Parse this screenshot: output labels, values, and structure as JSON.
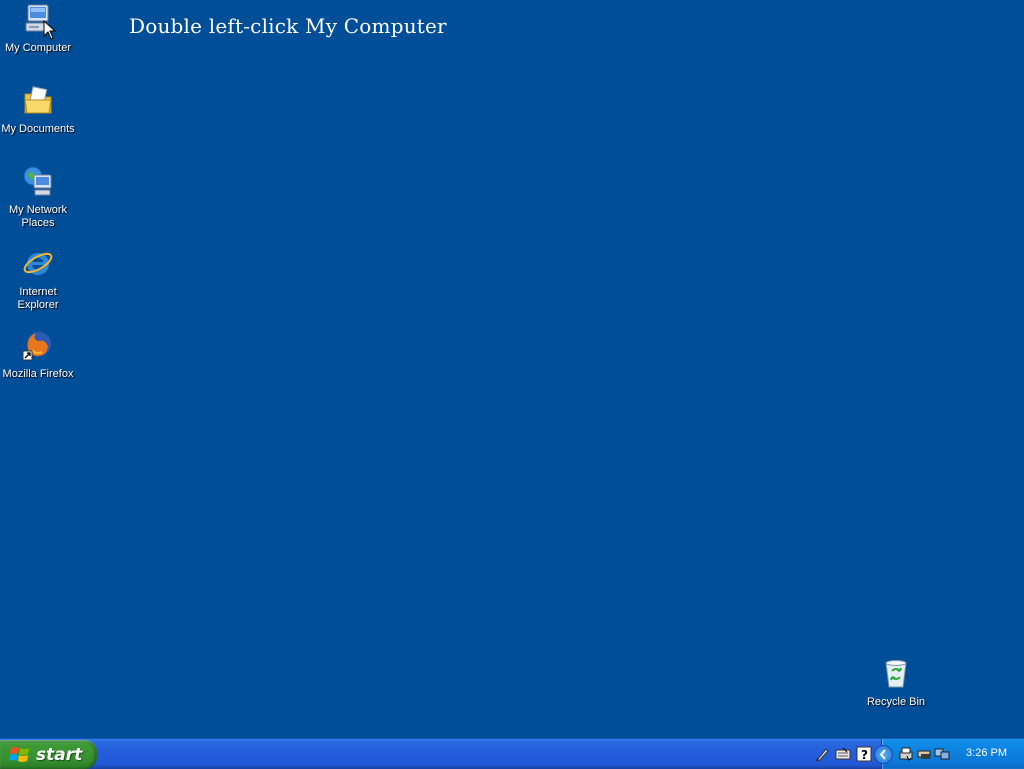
{
  "desktop": {
    "instruction": "Double left-click My Computer",
    "icons": [
      {
        "label": "My Computer",
        "icon": "my-computer-icon"
      },
      {
        "label": "My Documents",
        "icon": "my-documents-icon"
      },
      {
        "label": "My Network Places",
        "icon": "network-places-icon"
      },
      {
        "label": "Internet Explorer",
        "icon": "internet-explorer-icon"
      },
      {
        "label": "Mozilla Firefox",
        "icon": "firefox-icon"
      },
      {
        "label": "Recycle Bin",
        "icon": "recycle-bin-icon"
      }
    ],
    "background_color": "#004E98"
  },
  "taskbar": {
    "start_label": "start",
    "clock": "3:26 PM",
    "quick_launch": [
      "pen-icon",
      "keyboard-icon",
      "help-icon"
    ],
    "tray": [
      "chevron-icon",
      "printer-icon",
      "device-icon",
      "network-icon"
    ]
  }
}
